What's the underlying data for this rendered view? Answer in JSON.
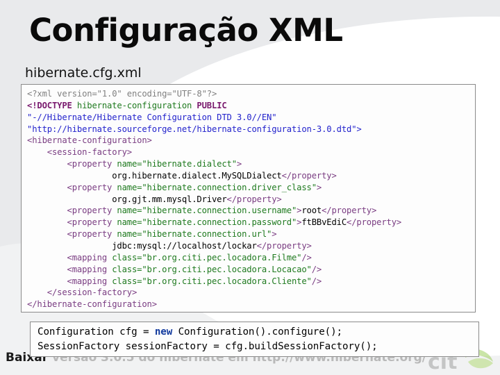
{
  "slide": {
    "title": "Configuração XML",
    "file_caption": "hibernate.cfg.xml",
    "footer_lead": "Baixar",
    "footer_rest": "versão 3.0.5 do hibernate em http://www.hibernate.org/",
    "footer_full": "Baixar versão 3.0.5 do hibernate em http://www.hibernate.org/",
    "watermark": "citi-logo"
  },
  "colors": {
    "background": "#ffffff",
    "swoosh": "#e9eaec",
    "box_border": "#8a8a8a",
    "box_fill": "#fdfdfd",
    "title": "#0a0a0a",
    "xml_declaration": "#808080",
    "xml_doctype": "#7a1a6e",
    "xml_tag": "#7a3d82",
    "xml_attribute": "#1f7a1f",
    "xml_string": "#2222cc",
    "xml_text": "#000000",
    "java_keyword": "#123a9e",
    "footer_text": "#b9b9b9",
    "logo_green": "#8cc63f",
    "logo_gray": "#9a9a9a"
  },
  "xml_code": {
    "language": "xml",
    "lines": [
      {
        "indent": 0,
        "tokens": [
          {
            "t": "decl",
            "v": "<?xml version=\"1.0\" encoding=\"UTF-8\"?>"
          }
        ]
      },
      {
        "indent": 0,
        "tokens": [
          {
            "t": "doctype",
            "v": "<!DOCTYPE "
          },
          {
            "t": "dtdname",
            "v": "hibernate-configuration "
          },
          {
            "t": "public",
            "v": "PUBLIC"
          }
        ]
      },
      {
        "indent": 0,
        "tokens": [
          {
            "t": "string",
            "v": "\"-//Hibernate/Hibernate Configuration DTD 3.0//EN\""
          }
        ]
      },
      {
        "indent": 0,
        "tokens": [
          {
            "t": "string",
            "v": "\"http://hibernate.sourceforge.net/hibernate-configuration-3.0.dtd\">"
          }
        ]
      },
      {
        "indent": 0,
        "tokens": [
          {
            "t": "tag",
            "v": "<hibernate-configuration>"
          }
        ]
      },
      {
        "indent": 4,
        "tokens": [
          {
            "t": "tag",
            "v": "<session-factory>"
          }
        ]
      },
      {
        "indent": 8,
        "tokens": [
          {
            "t": "tag",
            "v": "<property "
          },
          {
            "t": "attr",
            "v": "name="
          },
          {
            "t": "attrval",
            "v": "\"hibernate.dialect\""
          },
          {
            "t": "tag",
            "v": ">"
          }
        ]
      },
      {
        "indent": 17,
        "tokens": [
          {
            "t": "text",
            "v": "org.hibernate.dialect.MySQLDialect"
          },
          {
            "t": "tag",
            "v": "</property>"
          }
        ]
      },
      {
        "indent": 8,
        "tokens": [
          {
            "t": "tag",
            "v": "<property "
          },
          {
            "t": "attr",
            "v": "name="
          },
          {
            "t": "attrval",
            "v": "\"hibernate.connection.driver_class\""
          },
          {
            "t": "tag",
            "v": ">"
          }
        ]
      },
      {
        "indent": 17,
        "tokens": [
          {
            "t": "text",
            "v": "org.gjt.mm.mysql.Driver"
          },
          {
            "t": "tag",
            "v": "</property>"
          }
        ]
      },
      {
        "indent": 8,
        "tokens": [
          {
            "t": "tag",
            "v": "<property "
          },
          {
            "t": "attr",
            "v": "name="
          },
          {
            "t": "attrval",
            "v": "\"hibernate.connection.username\""
          },
          {
            "t": "tag",
            "v": ">"
          },
          {
            "t": "text",
            "v": "root"
          },
          {
            "t": "tag",
            "v": "</property>"
          }
        ]
      },
      {
        "indent": 8,
        "tokens": [
          {
            "t": "tag",
            "v": "<property "
          },
          {
            "t": "attr",
            "v": "name="
          },
          {
            "t": "attrval",
            "v": "\"hibernate.connection.password\""
          },
          {
            "t": "tag",
            "v": ">"
          },
          {
            "t": "text",
            "v": "ftBBvEdiC"
          },
          {
            "t": "tag",
            "v": "</property>"
          }
        ]
      },
      {
        "indent": 8,
        "tokens": [
          {
            "t": "tag",
            "v": "<property "
          },
          {
            "t": "attr",
            "v": "name="
          },
          {
            "t": "attrval",
            "v": "\"hibernate.connection.url\""
          },
          {
            "t": "tag",
            "v": ">"
          }
        ]
      },
      {
        "indent": 17,
        "tokens": [
          {
            "t": "text",
            "v": "jdbc:mysql://localhost/lockar"
          },
          {
            "t": "tag",
            "v": "</property>"
          }
        ]
      },
      {
        "indent": 8,
        "tokens": [
          {
            "t": "tag",
            "v": "<mapping "
          },
          {
            "t": "attr",
            "v": "class="
          },
          {
            "t": "attrval",
            "v": "\"br.org.citi.pec.locadora.Filme\""
          },
          {
            "t": "tag",
            "v": "/>"
          }
        ]
      },
      {
        "indent": 8,
        "tokens": [
          {
            "t": "tag",
            "v": "<mapping "
          },
          {
            "t": "attr",
            "v": "class="
          },
          {
            "t": "attrval",
            "v": "\"br.org.citi.pec.locadora.Locacao\""
          },
          {
            "t": "tag",
            "v": "/>"
          }
        ]
      },
      {
        "indent": 8,
        "tokens": [
          {
            "t": "tag",
            "v": "<mapping "
          },
          {
            "t": "attr",
            "v": "class="
          },
          {
            "t": "attrval",
            "v": "\"br.org.citi.pec.locadora.Cliente\""
          },
          {
            "t": "tag",
            "v": "/>"
          }
        ]
      },
      {
        "indent": 4,
        "tokens": [
          {
            "t": "tag",
            "v": "</session-factory>"
          }
        ]
      },
      {
        "indent": 0,
        "tokens": [
          {
            "t": "tag",
            "v": "</hibernate-configuration>"
          }
        ]
      }
    ]
  },
  "java_code": {
    "language": "java",
    "lines": [
      {
        "indent": 0,
        "tokens": [
          {
            "t": "text",
            "v": "Configuration cfg = "
          },
          {
            "t": "kw",
            "v": "new"
          },
          {
            "t": "text",
            "v": " Configuration().configure();"
          }
        ]
      },
      {
        "indent": 0,
        "tokens": [
          {
            "t": "text",
            "v": "SessionFactory sessionFactory = cfg.buildSessionFactory();"
          }
        ]
      }
    ]
  }
}
